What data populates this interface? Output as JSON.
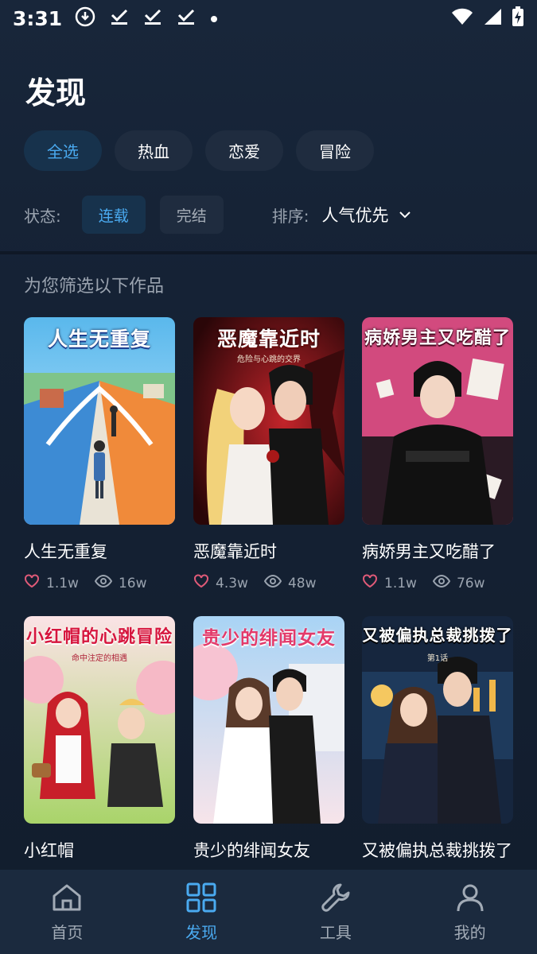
{
  "status_bar": {
    "time": "3:31",
    "icons_left": [
      "download-icon",
      "check-icon",
      "check-icon",
      "check-icon",
      "dot-icon"
    ],
    "icons_right": [
      "wifi-icon",
      "signal-icon",
      "battery-charging-icon"
    ]
  },
  "header": {
    "title": "发现"
  },
  "genres": [
    {
      "label": "全选",
      "active": true
    },
    {
      "label": "热血",
      "active": false
    },
    {
      "label": "恋爱",
      "active": false
    },
    {
      "label": "冒险",
      "active": false
    }
  ],
  "filters": {
    "status_label": "状态:",
    "status_options": [
      {
        "label": "连载",
        "active": true
      },
      {
        "label": "完结",
        "active": false
      }
    ],
    "sort_label": "排序:",
    "sort_value": "人气优先"
  },
  "section_title": "为您筛选以下作品",
  "books": [
    {
      "title": "人生无重复",
      "cover_title": "人生无重复",
      "cover_sub": "",
      "likes": "1.1w",
      "views": "16w"
    },
    {
      "title": "恶魔靠近时",
      "cover_title": "恶魔靠近时",
      "cover_sub": "危险与心跳的交界",
      "likes": "4.3w",
      "views": "48w"
    },
    {
      "title": "病娇男主又吃醋了",
      "cover_title": "病娇男主又吃醋了",
      "cover_sub": "",
      "likes": "1.1w",
      "views": "76w"
    },
    {
      "title": "小红帽",
      "cover_title": "小红帽的心跳冒险",
      "cover_sub": "命中注定的相遇",
      "likes": "",
      "views": ""
    },
    {
      "title": "贵少的绯闻女友",
      "cover_title": "贵少的绯闻女友",
      "cover_sub": "",
      "likes": "",
      "views": ""
    },
    {
      "title": "又被偏执总裁挑拨了",
      "cover_title": "又被偏执总裁挑拨了",
      "cover_sub": "第1话",
      "likes": "",
      "views": ""
    }
  ],
  "nav": [
    {
      "label": "首页",
      "icon": "home-icon",
      "active": false
    },
    {
      "label": "发现",
      "icon": "grid-icon",
      "active": true
    },
    {
      "label": "工具",
      "icon": "wrench-icon",
      "active": false
    },
    {
      "label": "我的",
      "icon": "user-icon",
      "active": false
    }
  ],
  "colors": {
    "accent": "#4aaaf0",
    "background": "#152235",
    "chip": "#1f2c3f",
    "chip_active": "#17324c",
    "nav_background": "#1b2a3e",
    "muted_text": "#9aa3af",
    "heart": "#e05a78"
  }
}
